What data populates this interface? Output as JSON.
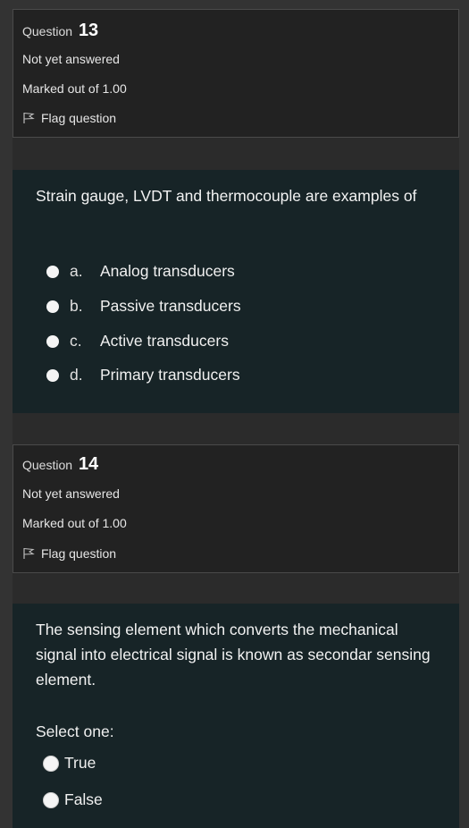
{
  "q13": {
    "label": "Question",
    "number": "13",
    "status": "Not yet answered",
    "marks": "Marked out of 1.00",
    "flag": "Flag question",
    "text": "Strain gauge, LVDT and thermocouple are examples of",
    "options": [
      {
        "letter": "a.",
        "text": "Analog transducers"
      },
      {
        "letter": "b.",
        "text": "Passive transducers"
      },
      {
        "letter": "c.",
        "text": "Active transducers"
      },
      {
        "letter": "d.",
        "text": "Primary transducers"
      }
    ]
  },
  "q14": {
    "label": "Question",
    "number": "14",
    "status": "Not yet answered",
    "marks": "Marked out of 1.00",
    "flag": "Flag question",
    "text": "The sensing element which converts the mechanical signal into electrical signal is known as secondar sensing element.",
    "select_one": "Select one:",
    "options": [
      {
        "text": "True"
      },
      {
        "text": "False"
      }
    ]
  },
  "colors": {
    "page_bg": "#333333",
    "info_bg": "#222222",
    "content_bg": "#172427",
    "radio": "#f5f5f5"
  }
}
